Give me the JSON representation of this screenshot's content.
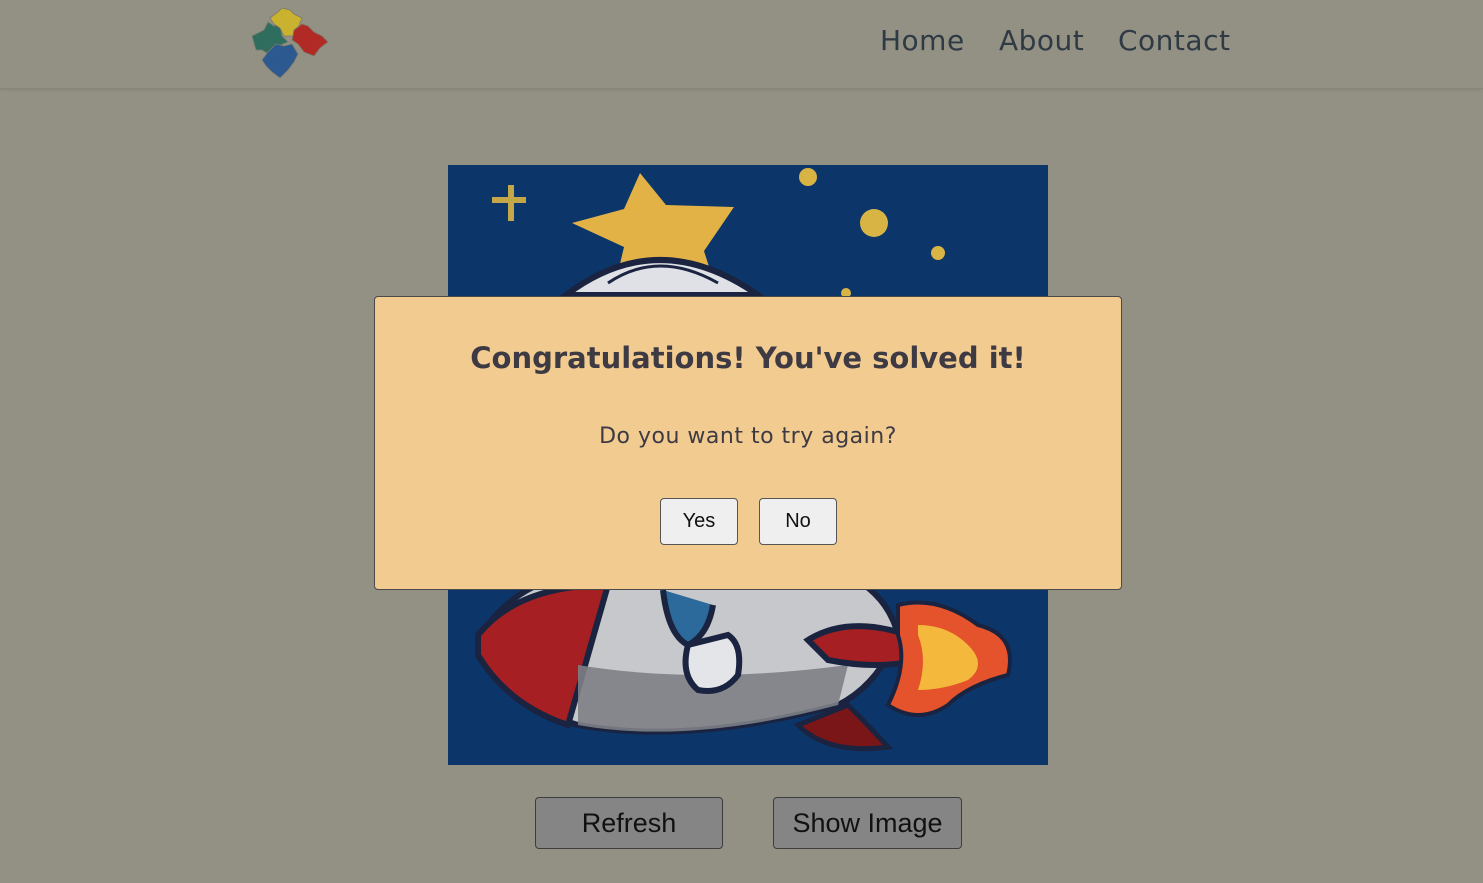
{
  "nav": {
    "logo": "puzzle-pieces-logo",
    "links": [
      "Home",
      "About",
      "Contact"
    ]
  },
  "puzzle": {
    "image": "astronaut-riding-rocket-illustration"
  },
  "modal": {
    "title": "Congratulations! You've solved it!",
    "message": "Do you want to try again?",
    "yes_label": "Yes",
    "no_label": "No"
  },
  "actions": {
    "refresh_label": "Refresh",
    "show_image_label": "Show Image"
  },
  "colors": {
    "page_background": "#929184",
    "modal_background": "#f2cb90",
    "image_background": "#0c3569",
    "text": "#3d3a44"
  }
}
